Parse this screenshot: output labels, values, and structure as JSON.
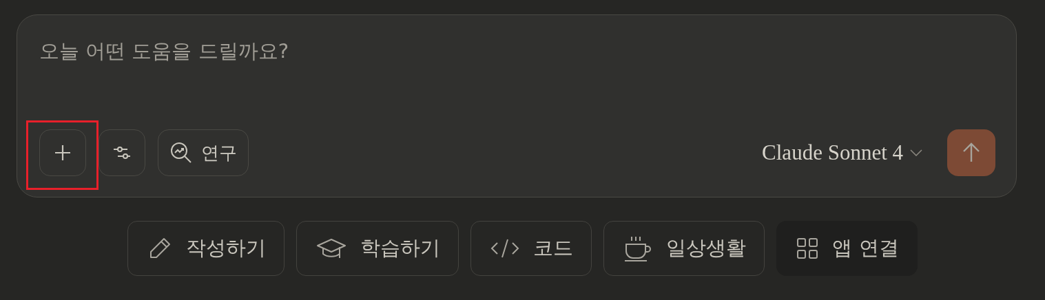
{
  "composer": {
    "placeholder": "오늘 어떤 도움을 드릴까요?",
    "tools": [
      {
        "kind": "add",
        "highlighted": true
      },
      {
        "kind": "settings",
        "highlighted": false
      },
      {
        "kind": "research",
        "label": "연구",
        "highlighted": false
      }
    ],
    "model": "Claude Sonnet 4"
  },
  "chips": [
    {
      "kind": "write",
      "label": "작성하기"
    },
    {
      "kind": "learn",
      "label": "학습하기"
    },
    {
      "kind": "code",
      "label": "코드"
    },
    {
      "kind": "life",
      "label": "일상생활"
    },
    {
      "kind": "apps",
      "label": "앱 연결"
    }
  ]
}
